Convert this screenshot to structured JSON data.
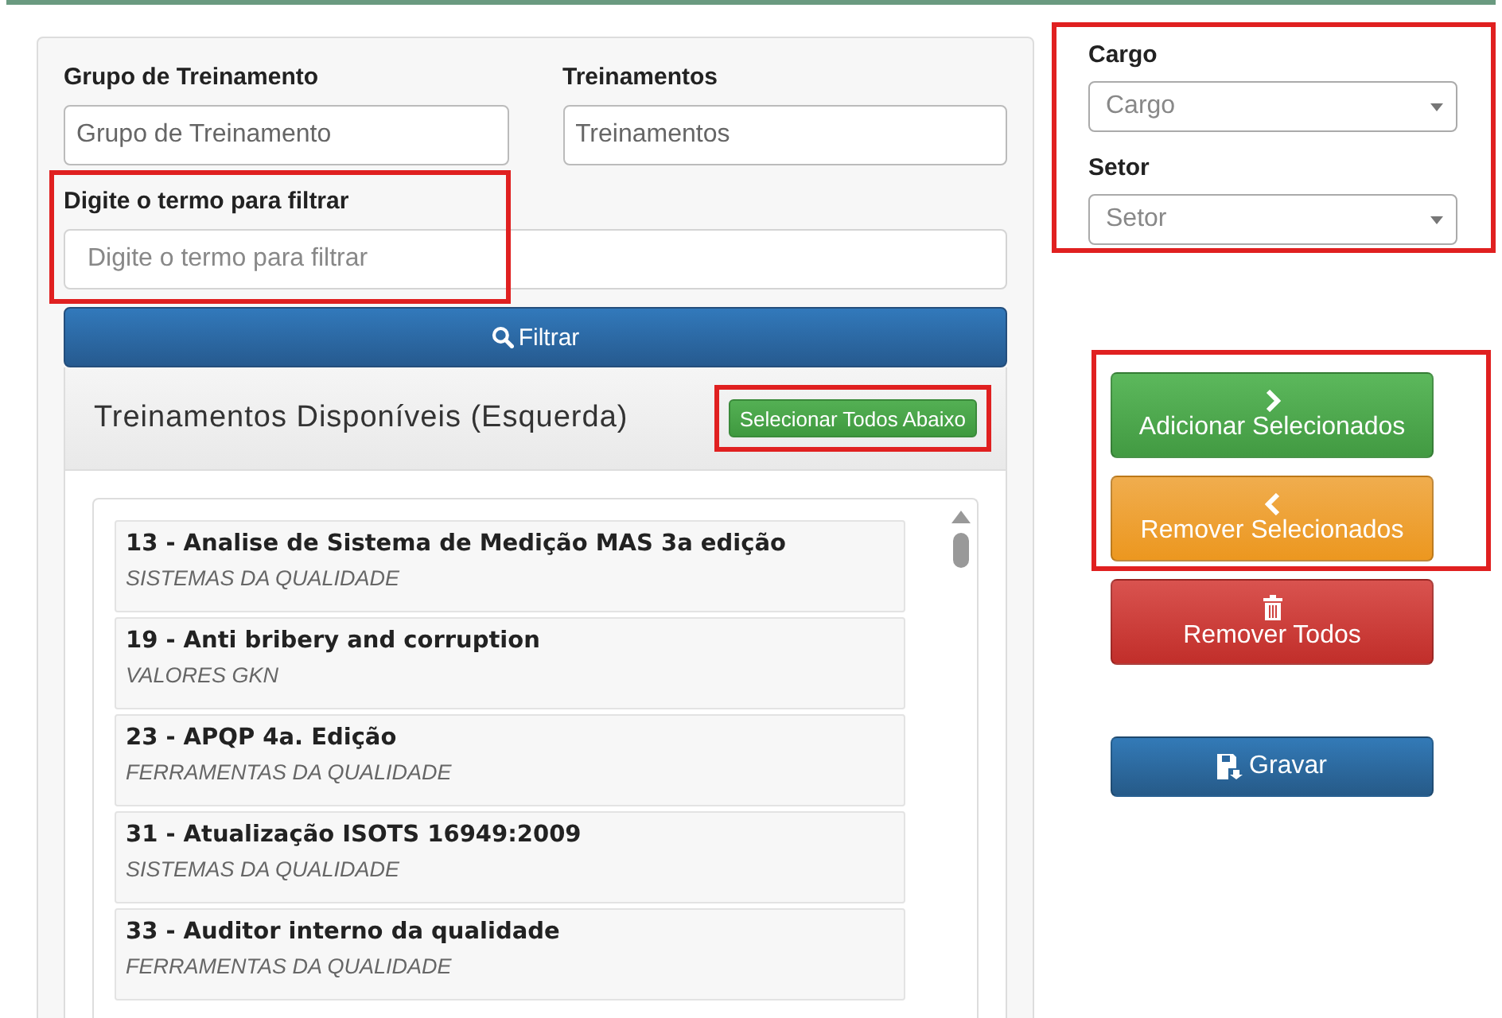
{
  "filters": [
    {
      "label": "Grupo de Treinamento",
      "placeholder": "Grupo de Treinamento"
    },
    {
      "label": "Treinamentos",
      "placeholder": "Treinamentos"
    }
  ],
  "search": {
    "label": "Digite o termo para filtrar",
    "placeholder": "Digite o termo para filtrar",
    "button": "Filtrar"
  },
  "available": {
    "title": "Treinamentos Disponíveis (Esquerda)",
    "select_all": "Selecionar Todos Abaixo",
    "items": [
      {
        "title": "13 - Analise de Sistema de Medição MAS 3a edição",
        "group": "SISTEMAS DA QUALIDADE"
      },
      {
        "title": "19 - Anti bribery and corruption",
        "group": "VALORES GKN"
      },
      {
        "title": "23 - APQP 4a. Edição",
        "group": "FERRAMENTAS DA QUALIDADE"
      },
      {
        "title": "31 - Atualização ISOTS 16949:2009",
        "group": "SISTEMAS DA QUALIDADE"
      },
      {
        "title": "33 - Auditor interno da qualidade",
        "group": "FERRAMENTAS DA QUALIDADE"
      }
    ]
  },
  "selects": [
    {
      "label": "Cargo",
      "placeholder": "Cargo"
    },
    {
      "label": "Setor",
      "placeholder": "Setor"
    }
  ],
  "actions": [
    {
      "kind": "add",
      "label": "Adicionar Selecionados"
    },
    {
      "kind": "remove",
      "label": "Remover Selecionados"
    },
    {
      "kind": "clear",
      "label": "Remover Todos"
    },
    {
      "kind": "save",
      "label": "Gravar"
    }
  ]
}
